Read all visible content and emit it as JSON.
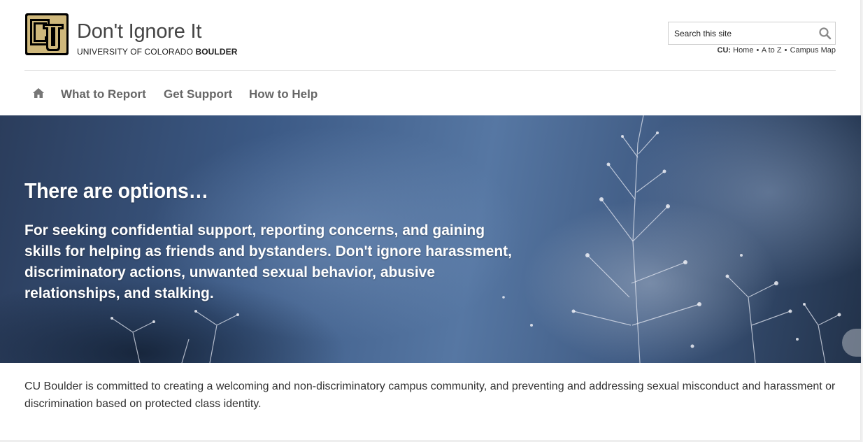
{
  "header": {
    "site_title": "Don't Ignore It",
    "subtitle_regular": "UNIVERSITY OF COLORADO ",
    "subtitle_bold": "BOULDER",
    "search_placeholder": "Search this site",
    "cu_label": "CU:",
    "cu_links": [
      "Home",
      "A to Z",
      "Campus Map"
    ],
    "cu_separator": "•"
  },
  "nav": {
    "home_icon": "home-icon",
    "items": [
      "What to Report",
      "Get Support",
      "How to Help"
    ]
  },
  "hero": {
    "title": "There are options…",
    "text": "For seeking confidential support, reporting concerns, and gaining skills for helping as friends and bystanders. Don't ignore harassment, discriminatory actions, unwanted sexual behavior, abusive relationships, and stalking."
  },
  "intro": {
    "text": "CU Boulder is committed to creating a welcoming and non-discriminatory campus community, and preventing and addressing sexual misconduct and harassment or discrimination based on protected class identity."
  },
  "colors": {
    "logo_gold": "#CFB87C",
    "logo_black": "#000000",
    "nav_text": "#666666",
    "hero_text": "#FFFFFF"
  }
}
